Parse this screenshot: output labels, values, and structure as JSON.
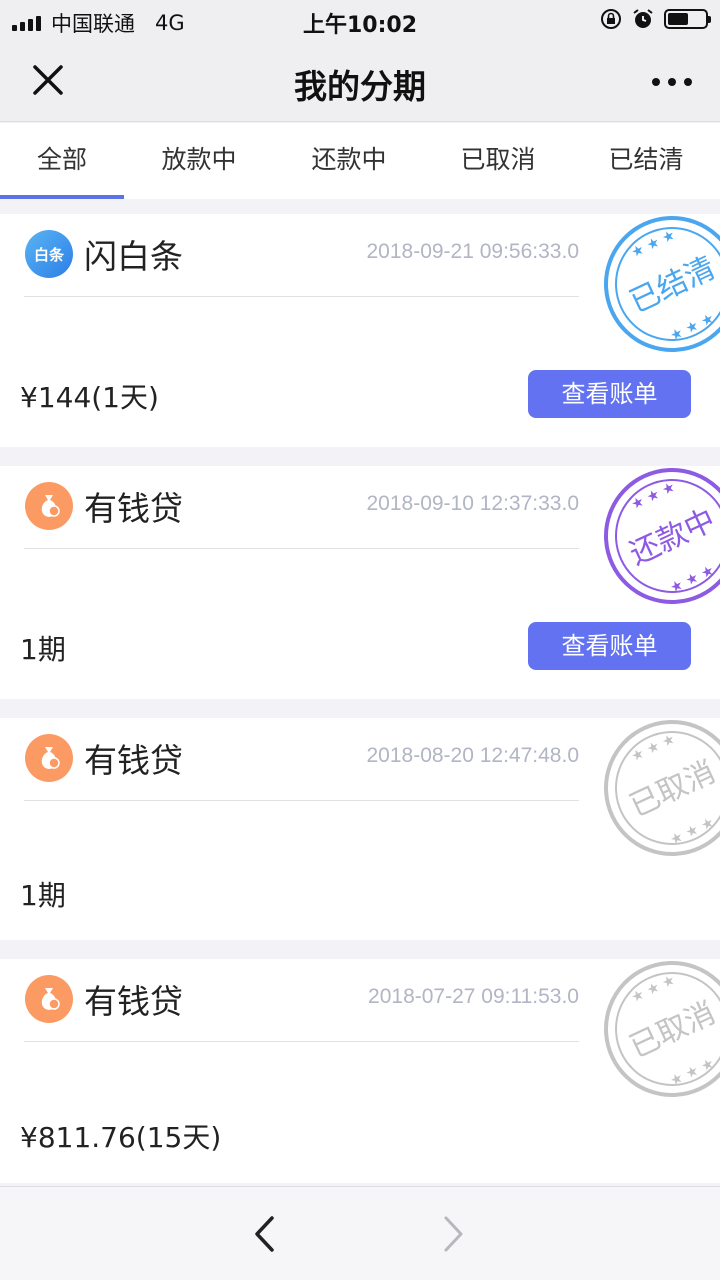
{
  "status_bar": {
    "carrier": "中国联通",
    "network": "4G",
    "time": "上午10:02",
    "battery_percent": 55
  },
  "header": {
    "title": "我的分期"
  },
  "tabs": [
    {
      "label": "全部",
      "active": true
    },
    {
      "label": "放款中",
      "active": false
    },
    {
      "label": "还款中",
      "active": false
    },
    {
      "label": "已取消",
      "active": false
    },
    {
      "label": "已结清",
      "active": false
    }
  ],
  "orders": [
    {
      "name": "闪白条",
      "icon": "baitiao-logo-icon",
      "icon_text": "白条",
      "time": "2018-09-21 09:56:33.0",
      "amount": "¥144(1天)",
      "button": "查看账单",
      "stamp": "已结清",
      "stamp_color": "#4aa6ee"
    },
    {
      "name": "有钱贷",
      "icon": "money-bag-icon",
      "time": "2018-09-10 12:37:33.0",
      "amount": "1期",
      "button": "查看账单",
      "stamp": "还款中",
      "stamp_color": "#8d5ae3"
    },
    {
      "name": "有钱贷",
      "icon": "money-bag-icon",
      "time": "2018-08-20 12:47:48.0",
      "amount": "1期",
      "stamp": "已取消",
      "stamp_color": "#c4c4c4"
    },
    {
      "name": "有钱贷",
      "icon": "money-bag-icon",
      "time": "2018-07-27 09:11:53.0",
      "amount": "¥811.76(15天)",
      "stamp": "已取消",
      "stamp_color": "#c4c4c4"
    }
  ],
  "colors": {
    "accent": "#5b73e8",
    "button": "#6272f0"
  }
}
